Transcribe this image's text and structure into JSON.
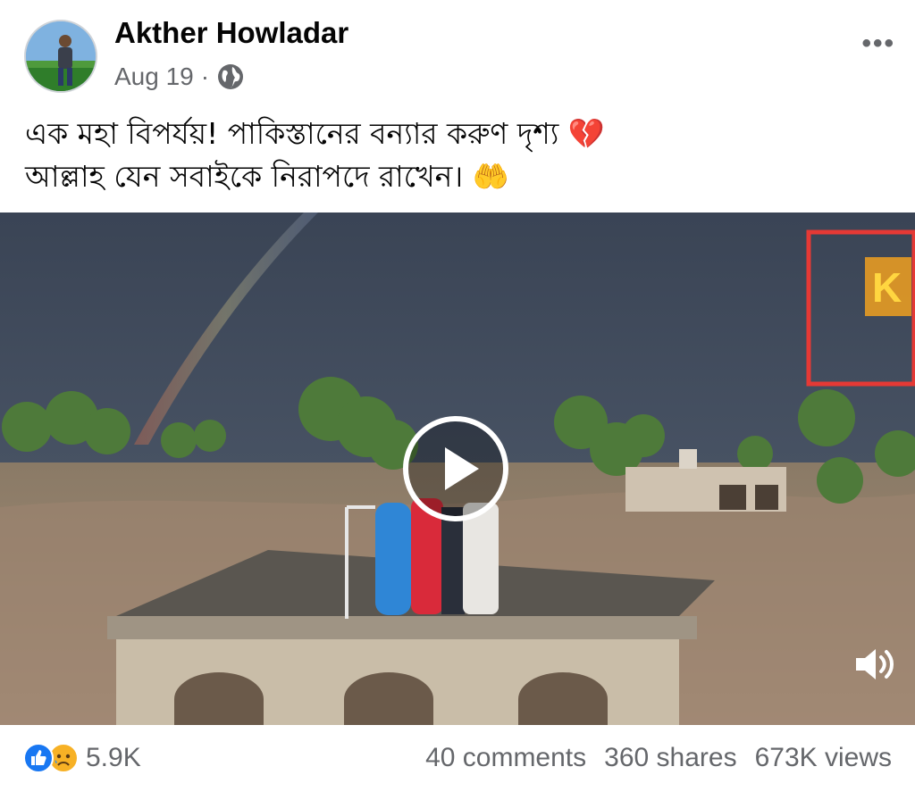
{
  "post": {
    "author": "Akther Howladar",
    "date": "Aug 19",
    "separator": "·",
    "privacy_icon": "globe-icon",
    "more_icon": "more-options-icon",
    "caption_line1": "এক মহা বিপর্যয়! পাকিস্তানের বন্যার করুণ দৃশ্য 💔",
    "caption_line2": "আল্লাহ যেন সবাইকে নিরাপদে রাখেন। 🤲"
  },
  "video": {
    "play_icon": "play-icon",
    "volume_icon": "volume-icon",
    "highlight_color": "#e53935"
  },
  "stats": {
    "reaction_icons": [
      "like-icon",
      "sad-icon"
    ],
    "reactions_count": "5.9K",
    "comments": "40 comments",
    "shares": "360 shares",
    "views": "673K views"
  },
  "colors": {
    "like_blue": "#1877f2",
    "sad_yellow": "#f7b125",
    "secondary_text": "#65676b"
  }
}
